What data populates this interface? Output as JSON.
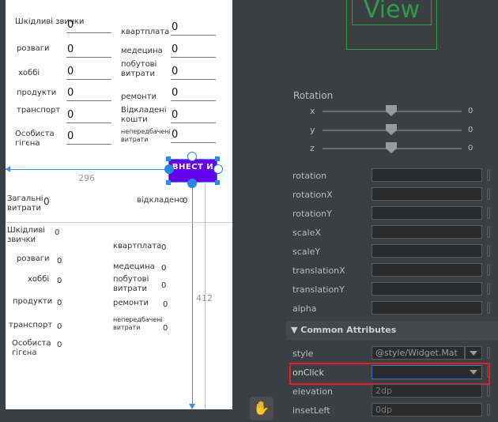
{
  "layout_preview": {
    "form_rows": [
      {
        "left_label": "Шкідливі звички",
        "left_value": "0",
        "right_label": "квартплата",
        "right_value": "0"
      },
      {
        "left_label": "розваги",
        "left_value": "0",
        "right_label": "медецина",
        "right_value": "0"
      },
      {
        "left_label": "хоббі",
        "left_value": "0",
        "right_label": "побутові витрати",
        "right_value": "0"
      },
      {
        "left_label": "продукти",
        "left_value": "0",
        "right_label": "ремонти",
        "right_value": "0"
      },
      {
        "left_label": "транспорт",
        "left_value": "0",
        "right_label": "Відкладені кошти",
        "right_value": "0"
      },
      {
        "left_label": "Особиста гігєна",
        "left_value": "0",
        "right_label": "непередбачені витрати",
        "right_value": "0"
      }
    ],
    "add_button": "ВНЕСТ И",
    "constraint_left": "296",
    "constraint_down": "412",
    "totals": {
      "spent_label": "Загальні витрати",
      "spent_value": "0",
      "saved_label": "відкладено",
      "saved_value": "0"
    },
    "summary_rows": [
      {
        "label": "Шкідливі звички",
        "value": "0"
      },
      {
        "label": "квартплата",
        "value": "0"
      },
      {
        "label": "розваги",
        "value": "0"
      },
      {
        "label": "медецина",
        "value": "0"
      },
      {
        "label": "хоббі",
        "value": "0"
      },
      {
        "label": "побутові витрати",
        "value": "0"
      },
      {
        "label": "продукти",
        "value": "0"
      },
      {
        "label": "ремонти",
        "value": "0"
      },
      {
        "label": "транспорт",
        "value": "0"
      },
      {
        "label": "непередбачені витрати",
        "value": "0"
      },
      {
        "label": "Особиста гігєна",
        "value": "0"
      }
    ]
  },
  "attributes_panel": {
    "preview_widget_text": "View",
    "rotation_title": "Rotation",
    "sliders": [
      {
        "axis": "x",
        "value": "0"
      },
      {
        "axis": "y",
        "value": "0"
      },
      {
        "axis": "z",
        "value": "0"
      }
    ],
    "transform_fields": [
      {
        "name": "rotation",
        "value": ""
      },
      {
        "name": "rotationX",
        "value": ""
      },
      {
        "name": "rotationY",
        "value": ""
      },
      {
        "name": "scaleX",
        "value": ""
      },
      {
        "name": "scaleY",
        "value": ""
      },
      {
        "name": "translationX",
        "value": ""
      },
      {
        "name": "translationY",
        "value": ""
      },
      {
        "name": "alpha",
        "value": ""
      }
    ],
    "common_section_title": "Common Attributes",
    "style_label": "style",
    "style_value": "@style/Widget.Mat",
    "onclick_label": "onClick",
    "onclick_value": "",
    "elevation_label": "elevation",
    "elevation_value": "2dp",
    "inset_left_label": "insetLeft",
    "inset_left_value": "0dp",
    "colors": {
      "highlight": "#e0202a",
      "button": "#6200ee",
      "constraint": "#2b87e4",
      "preview_outline": "#2e9c4a"
    }
  }
}
